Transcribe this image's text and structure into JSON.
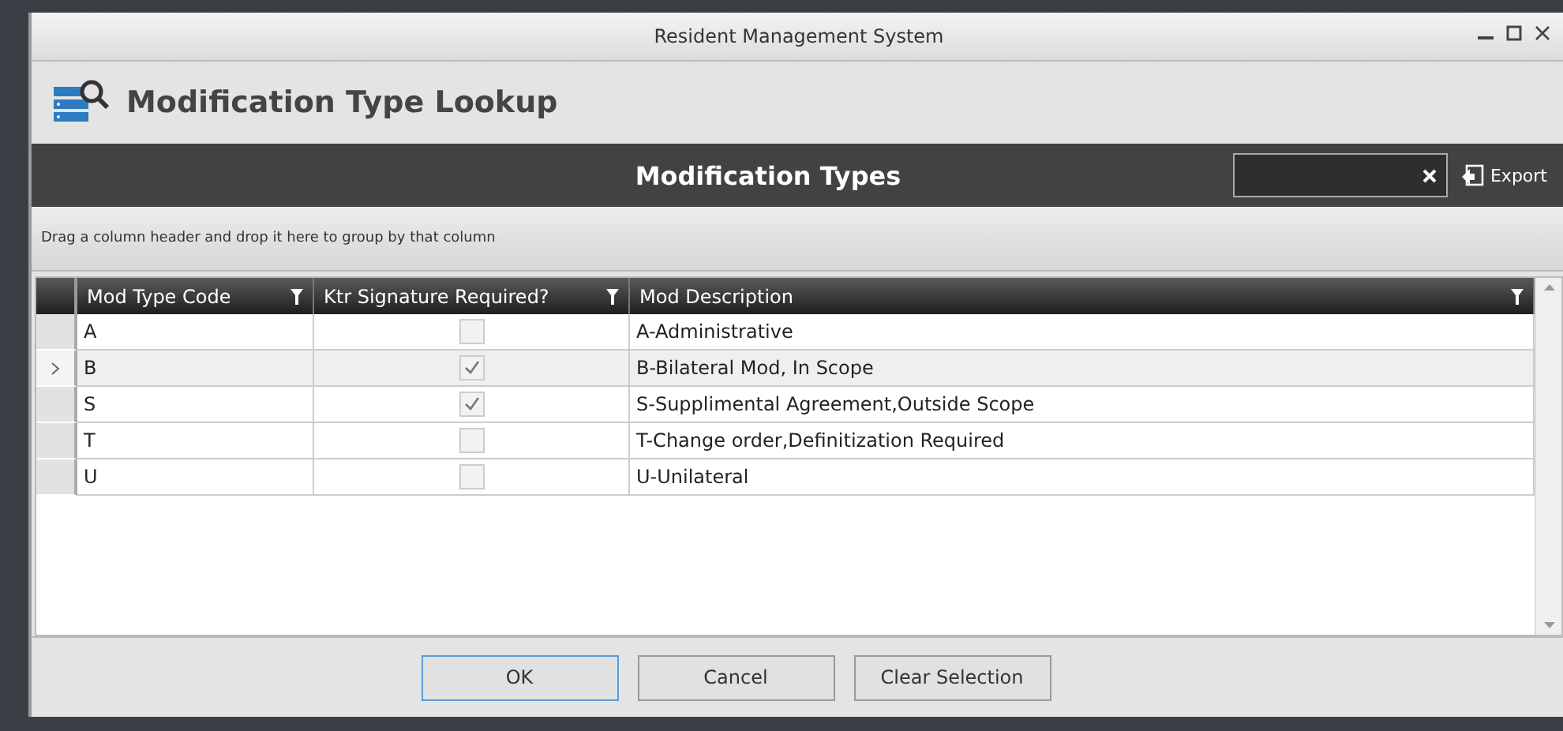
{
  "window": {
    "title": "Resident Management System"
  },
  "header": {
    "title": "Modification Type Lookup"
  },
  "grid": {
    "title": "Modification Types",
    "export_label": "Export",
    "group_hint": "Drag a column header and drop it here to group by that column",
    "columns": [
      {
        "label": "Mod Type Code",
        "filter": true
      },
      {
        "label": "Ktr Signature Required?",
        "filter": true
      },
      {
        "label": "Mod Description",
        "filter": true
      }
    ],
    "rows": [
      {
        "code": "A",
        "signature_required": false,
        "description": "A-Administrative",
        "selected": false
      },
      {
        "code": "B",
        "signature_required": true,
        "description": "B-Bilateral Mod, In Scope",
        "selected": true
      },
      {
        "code": "S",
        "signature_required": true,
        "description": "S-Supplimental Agreement,Outside Scope",
        "selected": false
      },
      {
        "code": "T",
        "signature_required": false,
        "description": "T-Change order,Definitization Required",
        "selected": false
      },
      {
        "code": "U",
        "signature_required": false,
        "description": "U-Unilateral",
        "selected": false
      }
    ]
  },
  "buttons": [
    {
      "label": "OK",
      "focused": true
    },
    {
      "label": "Cancel",
      "focused": false
    },
    {
      "label": "Clear Selection",
      "focused": false
    }
  ]
}
